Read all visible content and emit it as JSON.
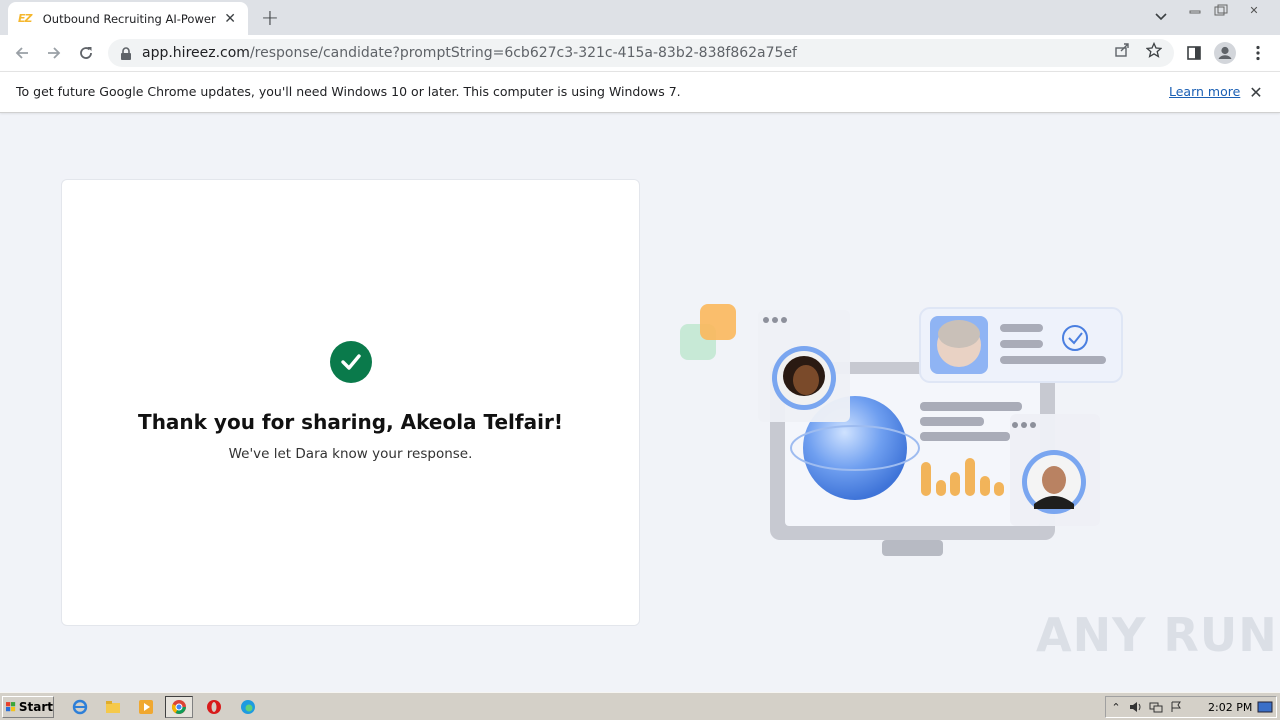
{
  "browser": {
    "tab_title": "Outbound Recruiting AI-Powered Pla",
    "tab_favicon_text": "EZ",
    "url_host": "app.hireez.com",
    "url_path": "/response/candidate?promptString=6cb627c3-321c-415a-83b2-838f862a75ef",
    "icons": [
      "back-icon",
      "forward-icon",
      "reload-icon",
      "lock-icon",
      "share-icon",
      "star-icon",
      "side-panel-icon",
      "profile-icon",
      "menu-icon",
      "new-tab-icon",
      "tab-search-icon"
    ]
  },
  "infobar": {
    "message": "To get future Google Chrome updates, you'll need Windows 10 or later. This computer is using Windows 7.",
    "link": "Learn more"
  },
  "page": {
    "heading": "Thank you for sharing, Akeola Telfair!",
    "subtext": "We've let Dara know your response.",
    "accent_color": "#0a7a4b"
  },
  "watermark": "ANY RUN",
  "taskbar": {
    "start_label": "Start",
    "clock": "2:02 PM",
    "apps": [
      "ie-icon",
      "explorer-icon",
      "media-player-icon",
      "chrome-icon",
      "opera-icon",
      "edge-icon"
    ]
  }
}
